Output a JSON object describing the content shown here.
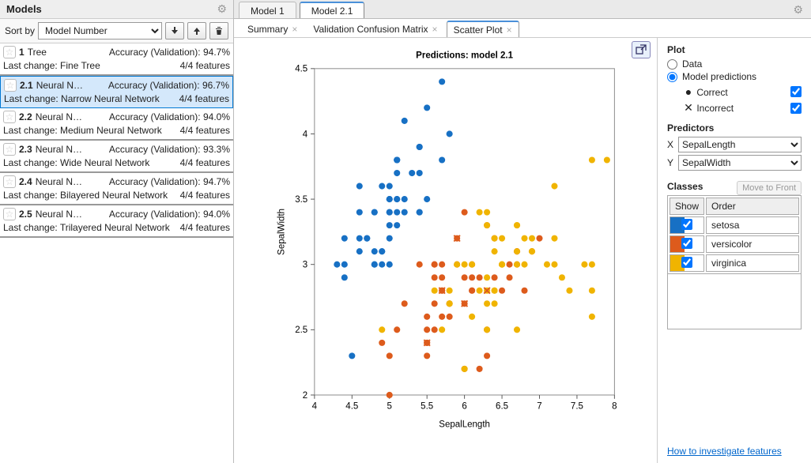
{
  "left": {
    "title": "Models",
    "sort_label": "Sort by",
    "sort_value": "Model Number",
    "items": [
      {
        "num": "1",
        "name": "Tree",
        "acc": "Accuracy (Validation): 94.7%",
        "lastchange": "Last change: Fine Tree",
        "feat": "4/4 features",
        "selected": false
      },
      {
        "num": "2.1",
        "name": "Neural Ne...",
        "acc": "Accuracy (Validation): 96.7%",
        "lastchange": "Last change: Narrow Neural Network",
        "feat": "4/4 features",
        "selected": true
      },
      {
        "num": "2.2",
        "name": "Neural Net...",
        "acc": "Accuracy (Validation): 94.0%",
        "lastchange": "Last change: Medium Neural Network",
        "feat": "4/4 features",
        "selected": false
      },
      {
        "num": "2.3",
        "name": "Neural Net...",
        "acc": "Accuracy (Validation): 93.3%",
        "lastchange": "Last change: Wide Neural Network",
        "feat": "4/4 features",
        "selected": false
      },
      {
        "num": "2.4",
        "name": "Neural Net...",
        "acc": "Accuracy (Validation): 94.7%",
        "lastchange": "Last change: Bilayered Neural Network",
        "feat": "4/4 features",
        "selected": false
      },
      {
        "num": "2.5",
        "name": "Neural Net...",
        "acc": "Accuracy (Validation): 94.0%",
        "lastchange": "Last change: Trilayered Neural Network",
        "feat": "4/4 features",
        "selected": false
      }
    ]
  },
  "editor_tabs": [
    "Model 1",
    "Model 2.1"
  ],
  "active_editor_tab": 1,
  "sub_tabs": [
    "Summary",
    "Validation Confusion Matrix",
    "Scatter Plot"
  ],
  "active_sub_tab": 2,
  "plot": {
    "title": "Predictions: model 2.1",
    "section_plot": "Plot",
    "opt_data": "Data",
    "opt_pred": "Model predictions",
    "legend_correct": "Correct",
    "legend_incorrect": "Incorrect",
    "section_predictors": "Predictors",
    "x_label": "X",
    "y_label": "Y",
    "x_value": "SepalLength",
    "y_value": "SepalWidth",
    "section_classes": "Classes",
    "move_front": "Move to Front",
    "th_show": "Show",
    "th_order": "Order",
    "classes": [
      {
        "name": "setosa",
        "color": "#1770c4"
      },
      {
        "name": "versicolor",
        "color": "#dd5b1c"
      },
      {
        "name": "virginica",
        "color": "#f0b400"
      }
    ],
    "link": "How to investigate features"
  },
  "chart_data": {
    "type": "scatter",
    "title": "Predictions: model 2.1",
    "xlabel": "SepalLength",
    "ylabel": "SepalWidth",
    "xlim": [
      4,
      8
    ],
    "ylim": [
      2,
      4.5
    ],
    "xticks": [
      4,
      4.5,
      5,
      5.5,
      6,
      6.5,
      7,
      7.5,
      8
    ],
    "yticks": [
      2,
      2.5,
      3,
      3.5,
      4,
      4.5
    ],
    "series": [
      {
        "name": "setosa",
        "color": "#1770c4",
        "marker": "o",
        "points": [
          [
            5.1,
            3.5
          ],
          [
            4.9,
            3.0
          ],
          [
            4.7,
            3.2
          ],
          [
            4.6,
            3.1
          ],
          [
            5.0,
            3.6
          ],
          [
            5.4,
            3.9
          ],
          [
            4.6,
            3.4
          ],
          [
            5.0,
            3.4
          ],
          [
            4.4,
            2.9
          ],
          [
            4.9,
            3.1
          ],
          [
            5.4,
            3.7
          ],
          [
            4.8,
            3.4
          ],
          [
            4.8,
            3.0
          ],
          [
            4.3,
            3.0
          ],
          [
            5.8,
            4.0
          ],
          [
            5.7,
            4.4
          ],
          [
            5.4,
            3.9
          ],
          [
            5.1,
            3.5
          ],
          [
            5.7,
            3.8
          ],
          [
            5.1,
            3.8
          ],
          [
            5.4,
            3.4
          ],
          [
            5.1,
            3.7
          ],
          [
            4.6,
            3.6
          ],
          [
            5.1,
            3.3
          ],
          [
            4.8,
            3.4
          ],
          [
            5.0,
            3.0
          ],
          [
            5.0,
            3.4
          ],
          [
            5.2,
            3.5
          ],
          [
            5.2,
            3.4
          ],
          [
            4.7,
            3.2
          ],
          [
            4.8,
            3.1
          ],
          [
            5.4,
            3.4
          ],
          [
            5.2,
            4.1
          ],
          [
            5.5,
            4.2
          ],
          [
            4.9,
            3.1
          ],
          [
            5.0,
            3.2
          ],
          [
            5.5,
            3.5
          ],
          [
            4.9,
            3.6
          ],
          [
            4.4,
            3.0
          ],
          [
            5.1,
            3.4
          ],
          [
            5.0,
            3.5
          ],
          [
            4.5,
            2.3
          ],
          [
            4.4,
            3.2
          ],
          [
            5.0,
            3.5
          ],
          [
            5.1,
            3.8
          ],
          [
            4.8,
            3.0
          ],
          [
            5.1,
            3.8
          ],
          [
            4.6,
            3.2
          ],
          [
            5.3,
            3.7
          ],
          [
            5.0,
            3.3
          ]
        ]
      },
      {
        "name": "versicolor",
        "color": "#dd5b1c",
        "marker": "o",
        "points": [
          [
            7.0,
            3.2
          ],
          [
            6.4,
            3.2
          ],
          [
            6.9,
            3.1
          ],
          [
            5.5,
            2.3
          ],
          [
            6.5,
            2.8
          ],
          [
            5.7,
            2.8
          ],
          [
            6.3,
            3.3
          ],
          [
            4.9,
            2.4
          ],
          [
            6.6,
            2.9
          ],
          [
            5.2,
            2.7
          ],
          [
            5.0,
            2.0
          ],
          [
            5.9,
            3.0
          ],
          [
            6.0,
            2.2
          ],
          [
            6.1,
            2.9
          ],
          [
            5.6,
            2.9
          ],
          [
            6.7,
            3.1
          ],
          [
            5.6,
            3.0
          ],
          [
            5.8,
            2.7
          ],
          [
            6.2,
            2.2
          ],
          [
            5.6,
            2.5
          ],
          [
            5.9,
            3.2
          ],
          [
            6.1,
            2.8
          ],
          [
            6.3,
            2.5
          ],
          [
            6.1,
            2.8
          ],
          [
            6.4,
            2.9
          ],
          [
            6.6,
            3.0
          ],
          [
            6.8,
            2.8
          ],
          [
            6.7,
            3.0
          ],
          [
            6.0,
            2.9
          ],
          [
            5.7,
            2.6
          ],
          [
            5.5,
            2.4
          ],
          [
            5.5,
            2.4
          ],
          [
            5.8,
            2.7
          ],
          [
            6.0,
            2.7
          ],
          [
            5.4,
            3.0
          ],
          [
            6.0,
            3.4
          ],
          [
            6.7,
            3.1
          ],
          [
            6.3,
            2.3
          ],
          [
            5.6,
            3.0
          ],
          [
            5.5,
            2.5
          ],
          [
            5.5,
            2.6
          ],
          [
            6.1,
            3.0
          ],
          [
            5.8,
            2.6
          ],
          [
            5.0,
            2.3
          ],
          [
            5.6,
            2.7
          ],
          [
            5.7,
            3.0
          ],
          [
            5.7,
            2.9
          ],
          [
            6.2,
            2.9
          ],
          [
            5.1,
            2.5
          ],
          [
            5.7,
            2.8
          ]
        ]
      },
      {
        "name": "virginica",
        "color": "#f0b400",
        "marker": "o",
        "points": [
          [
            6.3,
            3.3
          ],
          [
            5.8,
            2.7
          ],
          [
            7.1,
            3.0
          ],
          [
            6.3,
            2.9
          ],
          [
            6.5,
            3.0
          ],
          [
            7.6,
            3.0
          ],
          [
            4.9,
            2.5
          ],
          [
            7.3,
            2.9
          ],
          [
            6.7,
            2.5
          ],
          [
            7.2,
            3.6
          ],
          [
            6.5,
            3.2
          ],
          [
            6.4,
            2.7
          ],
          [
            6.8,
            3.0
          ],
          [
            5.7,
            2.5
          ],
          [
            5.8,
            2.8
          ],
          [
            6.4,
            3.2
          ],
          [
            6.5,
            3.0
          ],
          [
            7.7,
            3.8
          ],
          [
            7.7,
            2.6
          ],
          [
            6.0,
            2.2
          ],
          [
            6.9,
            3.2
          ],
          [
            5.6,
            2.8
          ],
          [
            7.7,
            2.8
          ],
          [
            6.3,
            2.7
          ],
          [
            6.7,
            3.3
          ],
          [
            7.2,
            3.2
          ],
          [
            6.2,
            2.8
          ],
          [
            6.1,
            3.0
          ],
          [
            6.4,
            2.8
          ],
          [
            7.2,
            3.0
          ],
          [
            7.4,
            2.8
          ],
          [
            7.9,
            3.8
          ],
          [
            6.4,
            2.8
          ],
          [
            6.3,
            2.8
          ],
          [
            6.1,
            2.6
          ],
          [
            7.7,
            3.0
          ],
          [
            6.3,
            3.4
          ],
          [
            6.4,
            3.1
          ],
          [
            6.0,
            3.0
          ],
          [
            6.9,
            3.1
          ],
          [
            6.7,
            3.1
          ],
          [
            6.9,
            3.1
          ],
          [
            5.8,
            2.7
          ],
          [
            6.8,
            3.2
          ],
          [
            6.7,
            3.3
          ],
          [
            6.7,
            3.0
          ],
          [
            6.3,
            2.5
          ],
          [
            6.5,
            3.0
          ],
          [
            6.2,
            3.4
          ],
          [
            5.9,
            3.0
          ]
        ]
      },
      {
        "name": "incorrect",
        "color": "#dd5b1c",
        "marker": "x",
        "points": [
          [
            5.9,
            3.2
          ],
          [
            6.0,
            2.7
          ],
          [
            5.7,
            2.8
          ],
          [
            6.3,
            2.8
          ],
          [
            5.5,
            2.4
          ]
        ]
      }
    ]
  }
}
